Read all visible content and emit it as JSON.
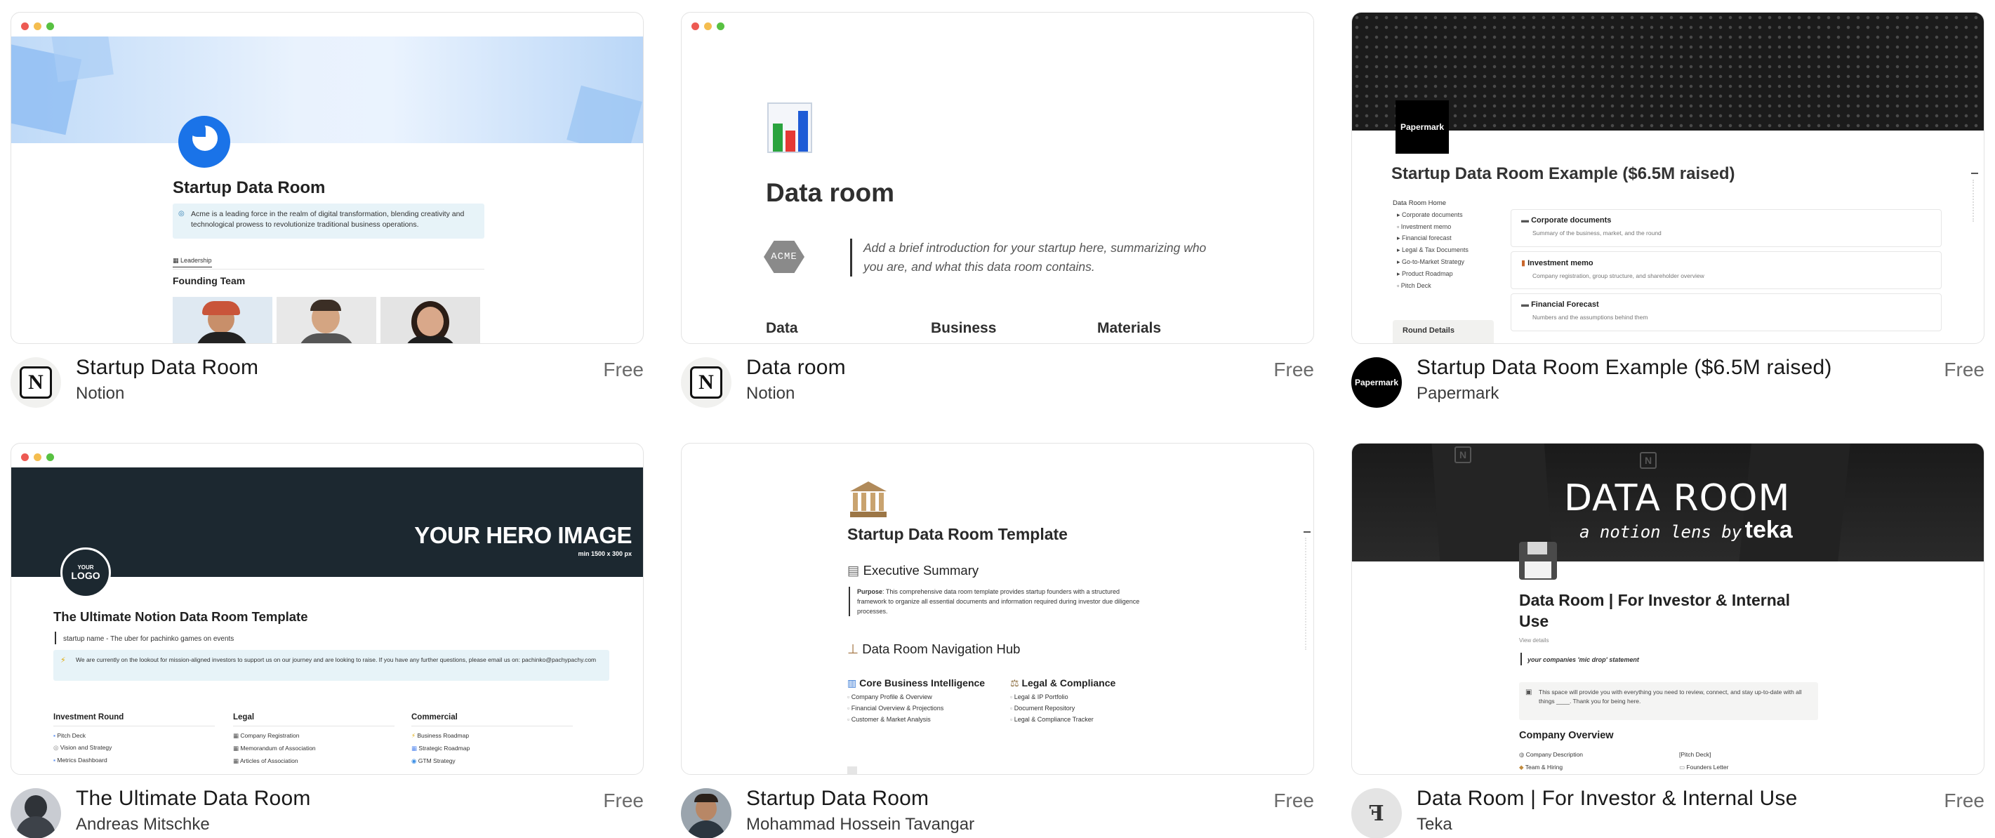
{
  "cards": [
    {
      "title": "Startup Data Room",
      "author": "Notion",
      "price": "Free",
      "preview": {
        "heading": "Startup Data Room",
        "callout": "Acme is a leading force in the realm of digital transformation, blending creativity and technological prowess to revolutionize traditional business operations.",
        "tab": "Leadership",
        "section": "Founding Team"
      }
    },
    {
      "title": "Data room",
      "author": "Notion",
      "price": "Free",
      "preview": {
        "heading": "Data room",
        "logo_text": "ACME",
        "intro": "Add a brief introduction for your startup here, summarizing who you are, and what this data room contains.",
        "columns": [
          "Data",
          "Business",
          "Materials"
        ]
      }
    },
    {
      "title": "Startup Data Room Example ($6.5M raised)",
      "author": "Papermark",
      "price": "Free",
      "preview": {
        "logo_text": "Papermark",
        "heading": "Startup Data Room Example ($6.5M raised)",
        "nav_home": "Data Room Home",
        "nav_items": [
          "Corporate documents",
          "Investment memo",
          "Financial forecast",
          "Legal & Tax Documents",
          "Go-to-Market Strategy",
          "Product Roadmap",
          "Pitch Deck"
        ],
        "round_label": "Round Details",
        "blocks": [
          {
            "title": "Corporate documents",
            "desc": "Summary of the business, market, and the round"
          },
          {
            "title": "Investment memo",
            "desc": "Company registration, group structure, and shareholder overview"
          },
          {
            "title": "Financial Forecast",
            "desc": "Numbers and the assumptions behind them"
          }
        ]
      }
    },
    {
      "title": "The Ultimate Data Room",
      "author": "Andreas Mitschke",
      "price": "Free",
      "preview": {
        "hero": "YOUR HERO IMAGE",
        "hero_sub": "min 1500 x 300 px",
        "logo_line1": "YOUR",
        "logo_line2": "LOGO",
        "heading": "The Ultimate Notion Data Room Template",
        "tagline": "startup name - The uber for pachinko games on events",
        "callout": "We are currently on the lookout for mission-aligned investors to support us on our journey and are looking to raise. If you have any further questions, please email us on: pachinko@pachypachy.com",
        "columns": [
          {
            "title": "Investment Round",
            "items": [
              "Pitch Deck",
              "Vision and Strategy",
              "Metrics Dashboard"
            ]
          },
          {
            "title": "Legal",
            "items": [
              "Company Registration",
              "Memorandum of Association",
              "Articles of Association"
            ]
          },
          {
            "title": "Commercial",
            "items": [
              "Business Roadmap",
              "Strategic Roadmap",
              "GTM Strategy"
            ]
          }
        ]
      }
    },
    {
      "title": "Startup Data Room",
      "author": "Mohammad Hossein Tavangar",
      "price": "Free",
      "preview": {
        "heading": "Startup Data Room Template",
        "exec_title": "Executive Summary",
        "purpose_label": "Purpose",
        "purpose": ": This comprehensive data room template provides startup founders with a structured framework to organize all essential documents and information required during investor due diligence processes.",
        "hub_title": "Data Room Navigation Hub",
        "left_title": "Core Business Intelligence",
        "left_items": [
          "Company Profile & Overview",
          "Financial Overview & Projections",
          "Customer & Market Analysis"
        ],
        "right_title": "Legal & Compliance",
        "right_items": [
          "Legal & IP Portfolio",
          "Document Repository",
          "Legal & Compliance Tracker"
        ]
      }
    },
    {
      "title": "Data Room | For Investor & Internal Use",
      "author": "Teka",
      "price": "Free",
      "preview": {
        "banner_title": "DATA ROOM",
        "banner_sub_a": "a notion lens by",
        "banner_sub_b": "teka",
        "heading": "Data Room | For Investor & Internal Use",
        "view_details": "View details",
        "quote": "your companies 'mic drop' statement",
        "callout": "This space will provide you with everything you need to review, connect, and stay up-to-date with all things ____. Thank you for being here.",
        "section": "Company Overview",
        "rows": [
          [
            "Company Description",
            "[Pitch Deck]"
          ],
          [
            "Team & Hiring",
            "Founders Letter"
          ]
        ]
      }
    }
  ],
  "colors": {
    "accent_blue": "#1a73e8",
    "dark_hero": "#1c2830",
    "callout_bg": "#e7f3f8"
  }
}
